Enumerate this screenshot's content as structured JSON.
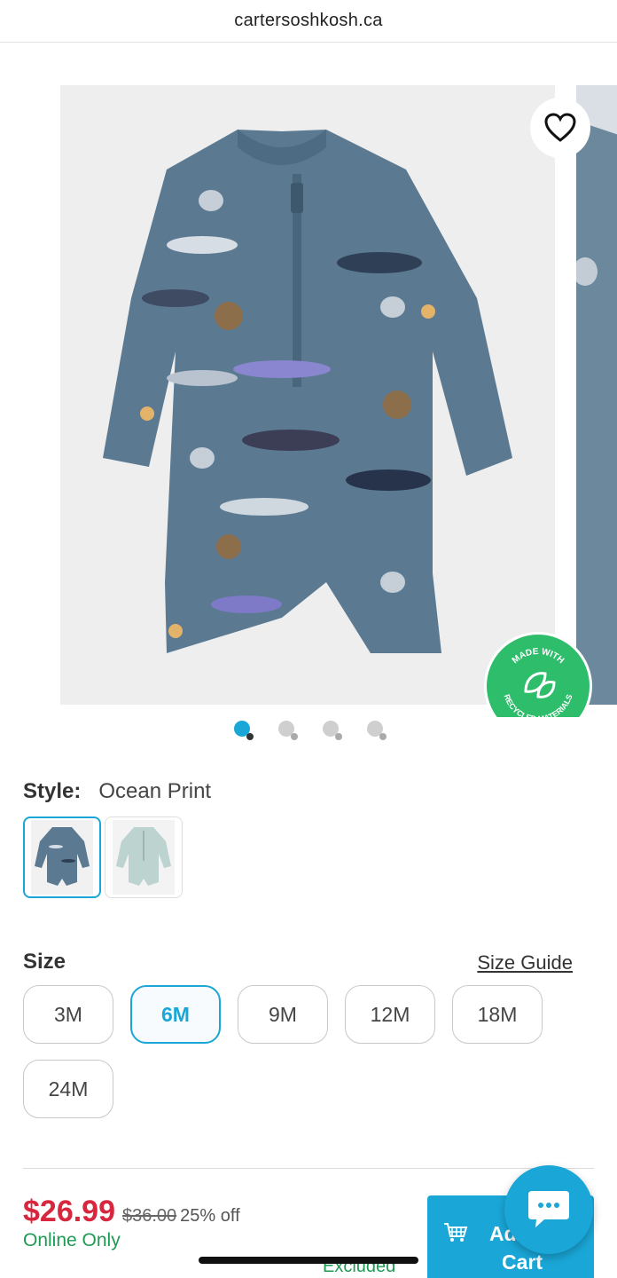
{
  "browser": {
    "url": "cartersoshkosh.ca"
  },
  "gallery": {
    "image_count": 4,
    "active_index": 0,
    "badge_lines": [
      "MADE WITH",
      "RECYCLED MATERIALS"
    ],
    "wishlist_icon": "heart-icon"
  },
  "style": {
    "label": "Style:",
    "value": "Ocean Print",
    "swatches": [
      "ocean-print-swatch",
      "mint-swatch"
    ],
    "selected": 0
  },
  "size": {
    "label": "Size",
    "guide_link": "Size Guide",
    "options": [
      "3M",
      "6M",
      "9M",
      "12M",
      "18M",
      "24M"
    ],
    "selected": "6M"
  },
  "price": {
    "current": "$26.99",
    "original": "$36.00",
    "discount": "25% off",
    "availability": "Online Only",
    "note": "Excluded"
  },
  "cart_button": {
    "line1": "Ad",
    "line2": "Cart",
    "icon": "cart-icon"
  },
  "chat_button": {
    "icon": "chat-icon"
  },
  "colors": {
    "accent": "#1aa7d8",
    "price": "#d7263d",
    "success": "#1f9a53",
    "badge": "#2ebd6b"
  }
}
